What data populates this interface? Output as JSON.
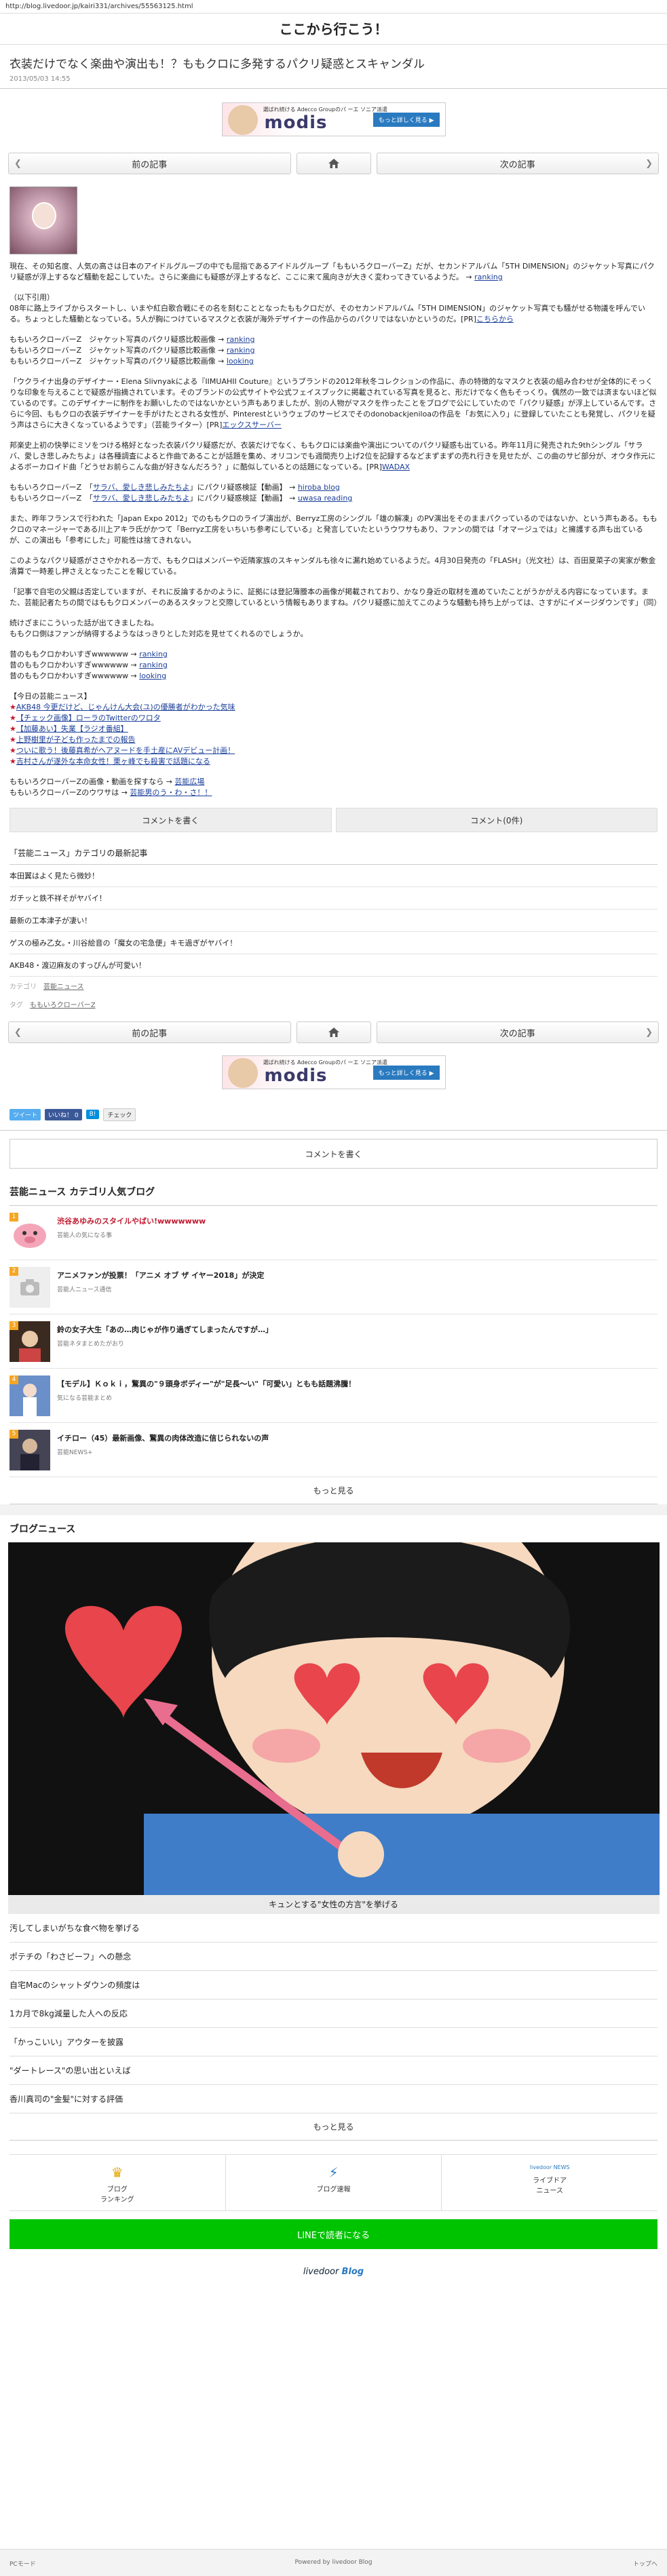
{
  "url": "http://blog.livedoor.jp/kairi331/archives/55563125.html",
  "site_title": "ここから行こう！",
  "article": {
    "title": "衣装だけでなく楽曲や演出も！？ももクロに多発するパクリ疑惑とスキャンダル",
    "date": "2013/05/03 14:55"
  },
  "ad": {
    "tagline": "選ばれ続ける Adecco Groupのパ ーエ ソニア派遣",
    "logo": "modis",
    "cta": "もっと詳しく見る ▶"
  },
  "nav": {
    "prev": "前の記事",
    "next": "次の記事"
  },
  "body": {
    "p1": "現在、その知名度、人気の高さは日本のアイドルグループの中でも屈指であるアイドルグループ「ももいろクローバーZ」だが、セカンドアルバム「5TH DIMENSION」のジャケット写真にパクリ疑惑が浮上するなど騒動を起こしていた。さらに楽曲にも疑惑が浮上するなど、ここに来て風向きが大きく変わってきているようだ。",
    "p1_link": "ranking",
    "p2_head": "（以下引用）",
    "p2": "08年に路上ライブからスタートし、いまや紅白歌合戦にその名を刻むこととなったももクロだが、そのセカンドアルバム「5TH DIMENSION」のジャケット写真でも騒がせる物議を呼んでいる。ちょっとした騒動となっている。5人が胸につけているマスクと衣装が海外デザイナーの作品からのパクリではないかというのだ。[PR]",
    "p2_pr": "こちらから",
    "cmp": [
      {
        "text": "ももいろクローバーZ　ジャケット写真のパクリ疑惑比較画像 →",
        "link": "ranking"
      },
      {
        "text": "ももいろクローバーZ　ジャケット写真のパクリ疑惑比較画像 →",
        "link": "ranking"
      },
      {
        "text": "ももいろクローバーZ　ジャケット写真のパクリ疑惑比較画像 →",
        "link": "looking"
      }
    ],
    "p3": "「ウクライナ出身のデザイナー・Elena Slivnyakによる『IIMUAHII Couture』というブランドの2012年秋冬コレクションの作品に、赤の特徴的なマスクと衣装の組み合わせが全体的にそっくりな印象を与えることで疑惑が指摘されています。そのブランドの公式サイトや公式フェイスブックに掲載されている写真を見ると、形だけでなく色もそっくり。偶然の一致では済まないほど似ているのです。このデザイナーに制作をお願いしたのではないかという声もありましたが、別の人物がマスクを作ったことをブログで公にしていたので「パクリ疑惑」が浮上しているんです。さらに今回、ももクロの衣装デザイナーを手がけたとされる女性が、Pinterestというウェブのサービスでそのdonobackjeniloaの作品を「お気に入り」に登録していたことも発覚し、パクリを疑う声はさらに大きくなっているようです」（芸能ライター）[PR]",
    "p3_pr": "エックスサーバー",
    "p4": "邦楽史上初の快挙にミソをつける格好となった衣装パクリ疑惑だが、衣装だけでなく、ももクロには楽曲や演出についてのパクリ疑惑も出ている。昨年11月に発売された9thシングル「サラバ、愛しき悲しみたちよ」は各種調査によると作曲であることが話題を集め、オリコンでも週間売り上げ2位を記録するなどまずまずの売れ行きを見せたが、この曲のサビ部分が、オウタ作元によるボーカロイド曲「どうせお前らこんな曲が好きなんだろう？」に酷似しているとの話題になっている。[PR]",
    "p4_pr": "WADAX",
    "cmp2": [
      {
        "pre": "ももいろクローバーZ　「",
        "song": "サラバ、愛しき悲しみたちよ",
        "post": "」にパクリ疑惑検証【動画】 →",
        "link": "hiroba blog"
      },
      {
        "pre": "ももいろクローバーZ　「",
        "song": "サラバ、愛しき悲しみたちよ",
        "post": "」にパクリ疑惑検証【動画】 →",
        "link": "uwasa reading"
      }
    ],
    "p5": "また、昨年フランスで行われた「Japan Expo 2012」でのももクロのライブ演出が、Berryz工房のシングル「雄の解凍」のPV演出をそのままパクっているのではないか、という声もある。ももクロのマネージャーである川上アキラ氏がかつて「Berryz工房をいちいち参考にしている」と発言していたというウワサもあり、ファンの間では「オマージュでは」と擁護する声も出ているが、この演出も「参考にした」可能性は捨てきれない。",
    "p6": "このようなパクリ疑惑がささやかれる一方で、ももクロはメンバーや近隣家族のスキャンダルも徐々に漏れ始めているようだ。4月30日発売の「FLASH」（光文社）は、百田夏菜子の実家が敷金清算で一時差し押さえとなったことを報じている。",
    "p7": "「記事で自宅の父親は否定していますが、それに反論するかのように、証拠には登記簿謄本の画像が掲載されており、かなり身近の取材を進めていたことがうかがえる内容になっています。また、芸能記者たちの間ではももクロメンバーのあるスタッフと交際しているという情報もありますね。パクリ疑惑に加えてこのような騒動も持ち上がっては、さすがにイメージダウンです」（同）",
    "p8": "続けざまにこういった話が出てきましたね。\nももクロ側はファンが納得するようなはっきりとした対応を見せてくれるのでしょうか。",
    "cute": [
      {
        "text": "昔のももクロかわいすぎwwwwww →",
        "link": "ranking"
      },
      {
        "text": "昔のももクロかわいすぎwwwwww →",
        "link": "ranking"
      },
      {
        "text": "昔のももクロかわいすぎwwwwww →",
        "link": "looking"
      }
    ],
    "news_head": "【今日の芸能ニュース】",
    "news": [
      "AKB48 今更だけど、じゃんけん大会(ユ)の優勝者がわかった気味",
      "【チェック画像】ローラのTwitterのワロタ",
      "【加藤あい】失業【ラジオ番組】",
      "上野樹里が子ども作ったまでの報告",
      "ついに歌う！後藤真希がヘアヌードを手土産にAVデビュー計画！",
      "吉村さんが遂外な本命女性！栗ヶ峰でも殺害で話題になる"
    ],
    "outro": [
      {
        "text": "ももいろクローバーZの画像・動画を探すなら →",
        "link": "芸能広場"
      },
      {
        "text": "ももいろクローバーZのウワサは →",
        "link": "芸能男のう・わ・さ！！"
      }
    ]
  },
  "buttons": {
    "write_comment": "コメントを書く",
    "comments": "コメント(0件)"
  },
  "category": {
    "head": "「芸能ニュース」カテゴリの最新記事",
    "items": [
      "本田翼はよく見たら微妙！",
      "ガチッと鉄不祥そがヤバイ！",
      "最新の工本津子が凄い！",
      "ゲスの極み乙女。・川谷絵音の「魔女の宅急便」キモ過ぎがヤバイ！",
      "AKB48・渡辺麻友のすっぴんが可愛い！"
    ]
  },
  "meta": {
    "cat_label": "カテゴリ",
    "cat_value": "芸能ニュース",
    "tag_label": "タグ",
    "tag_value": "ももいろクローバーZ"
  },
  "share": {
    "tweet": "ツイート",
    "like": "いいね！ 0",
    "hatena": "B!",
    "check": "チェック"
  },
  "popular": {
    "head": "芸能ニュース カテゴリ人気ブログ",
    "items": [
      {
        "rank": "1",
        "title": "渋谷あゆみのスタイルやばい!wwwwwww",
        "source": "芸能人の気になる事"
      },
      {
        "rank": "2",
        "title": "アニメファンが投票！「アニメ オブ ザ イヤー2018」が決定",
        "source": "芸能人ニュース通信"
      },
      {
        "rank": "3",
        "title": "鈴の女子大生「あの…肉じゃが作り過ぎてしまったんですが…」",
        "source": "芸能ネタまとめたがおり"
      },
      {
        "rank": "4",
        "title": "【モデル】Ｋｏｋｉ，驚異の\"９頭身ボディー\"が\"足長〜い\"「可愛い」ともも話題沸騰！",
        "source": "気になる芸能まとめ"
      },
      {
        "rank": "5",
        "title": "イチロー（45）最新画像、驚異の肉体改造に信じられないの声",
        "source": "芸能NEWS+"
      }
    ],
    "more": "もっと見る"
  },
  "blog_news": {
    "head": "ブログニュース",
    "hero_caption": "キュンとする\"女性の方言\"を挙げる",
    "items": [
      "汚してしまいがちな食べ物を挙げる",
      "ポテチの「わさビーフ」への懸念",
      "自宅Macのシャットダウンの頻度は",
      "1カ月で8kg減量した人への反応",
      "「かっこいい」アウターを披露",
      "\"ダートレース\"の思い出といえば",
      "香川真司の\"金髪\"に対する評価"
    ],
    "more": "もっと見る"
  },
  "footer": {
    "ranking": "ブログ\nランキング",
    "speed": "ブログ速報",
    "news": "ライブドア\nニュース",
    "news_tag": "livedoor NEWS",
    "line": "LINEで読者になる",
    "logo": "livedoor",
    "logo_b": "Blog",
    "pc": "PCモード",
    "powered": "Powered by livedoor Blog",
    "top": "トップへ"
  }
}
